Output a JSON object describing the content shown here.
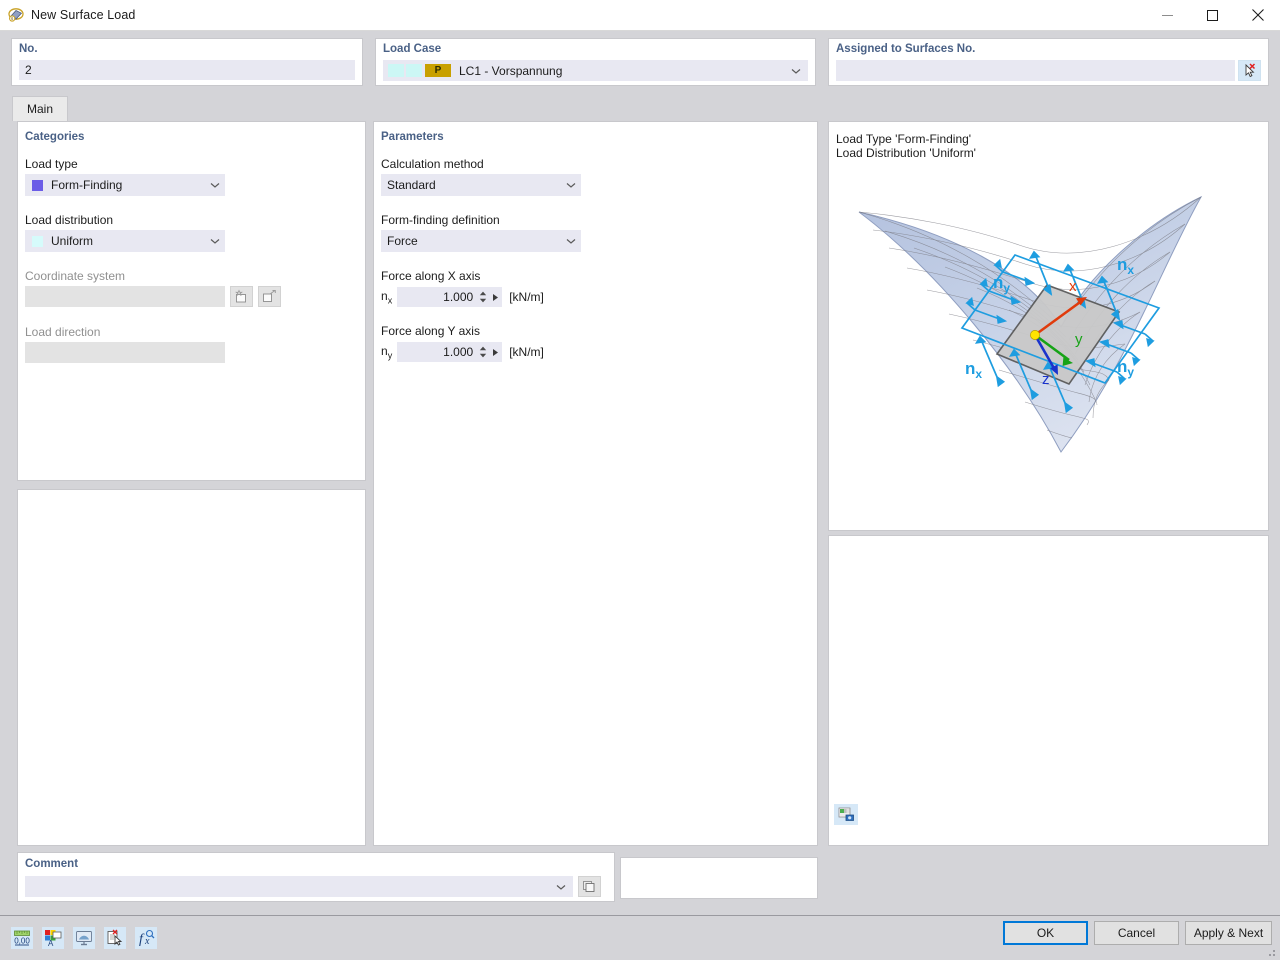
{
  "window": {
    "title": "New Surface Load",
    "icon": "surface-load-icon",
    "controls": {
      "minimize": "—",
      "maximize": "□",
      "close": "✕"
    }
  },
  "header": {
    "no": {
      "label": "No.",
      "value": "2"
    },
    "load_case": {
      "label": "Load Case",
      "value": "LC1 - Vorspannung",
      "badge": "P",
      "badge_color": "#c8a000",
      "swatch1_color": "#ccf7f5",
      "swatch2_color": "#ccf7f5"
    },
    "assigned": {
      "label": "Assigned to Surfaces No.",
      "value": "",
      "placeholder": "",
      "pick_button": "pick-surfaces-button"
    }
  },
  "tabs": [
    {
      "label": "Main",
      "active": true
    }
  ],
  "categories": {
    "title": "Categories",
    "load_type": {
      "label": "Load type",
      "value": "Form-Finding",
      "swatch_color": "#6b5ce7"
    },
    "load_distribution": {
      "label": "Load distribution",
      "value": "Uniform",
      "swatch_color": "#d6fbfb"
    },
    "coordinate_system": {
      "label": "Coordinate system",
      "value": "",
      "enabled": false,
      "buttons": [
        "new-coordinate-system-button",
        "edit-coordinate-system-button"
      ]
    },
    "load_direction": {
      "label": "Load direction",
      "value": "",
      "enabled": false
    }
  },
  "parameters": {
    "title": "Parameters",
    "calculation_method": {
      "label": "Calculation method",
      "value": "Standard"
    },
    "form_finding_definition": {
      "label": "Form-finding definition",
      "value": "Force"
    },
    "force_x": {
      "label": "Force along X axis",
      "symbol": "n",
      "subscript": "x",
      "value": "1.000",
      "unit": "[kN/m]"
    },
    "force_y": {
      "label": "Force along Y axis",
      "symbol": "n",
      "subscript": "y",
      "value": "1.000",
      "unit": "[kN/m]"
    }
  },
  "preview": {
    "line1": "Load Type 'Form-Finding'",
    "line2": "Load Distribution 'Uniform'",
    "labels": {
      "nx_top": "n",
      "nx_top_sub": "x",
      "ny_left": "n",
      "ny_left_sub": "y",
      "nx_bottom": "n",
      "nx_bottom_sub": "x",
      "ny_right": "n",
      "ny_right_sub": "y",
      "axis_x": "x",
      "axis_y": "y",
      "axis_z": "z"
    },
    "colors": {
      "arrow": "#1e9de0",
      "surface": "#a9b8da",
      "axis_x": "#e03b0c",
      "axis_y": "#17a317",
      "axis_z": "#1a33cc",
      "origin": "#ffe400"
    },
    "image_button": "image-settings-button"
  },
  "comment": {
    "label": "Comment",
    "value": "",
    "placeholder": "",
    "button": "comment-library-button"
  },
  "toolbar": [
    {
      "name": "units-decimal-places-button"
    },
    {
      "name": "display-properties-button"
    },
    {
      "name": "visibility-button"
    },
    {
      "name": "select-objects-button"
    },
    {
      "name": "formula-button"
    }
  ],
  "buttons": {
    "ok": "OK",
    "cancel": "Cancel",
    "apply_next": "Apply & Next"
  }
}
